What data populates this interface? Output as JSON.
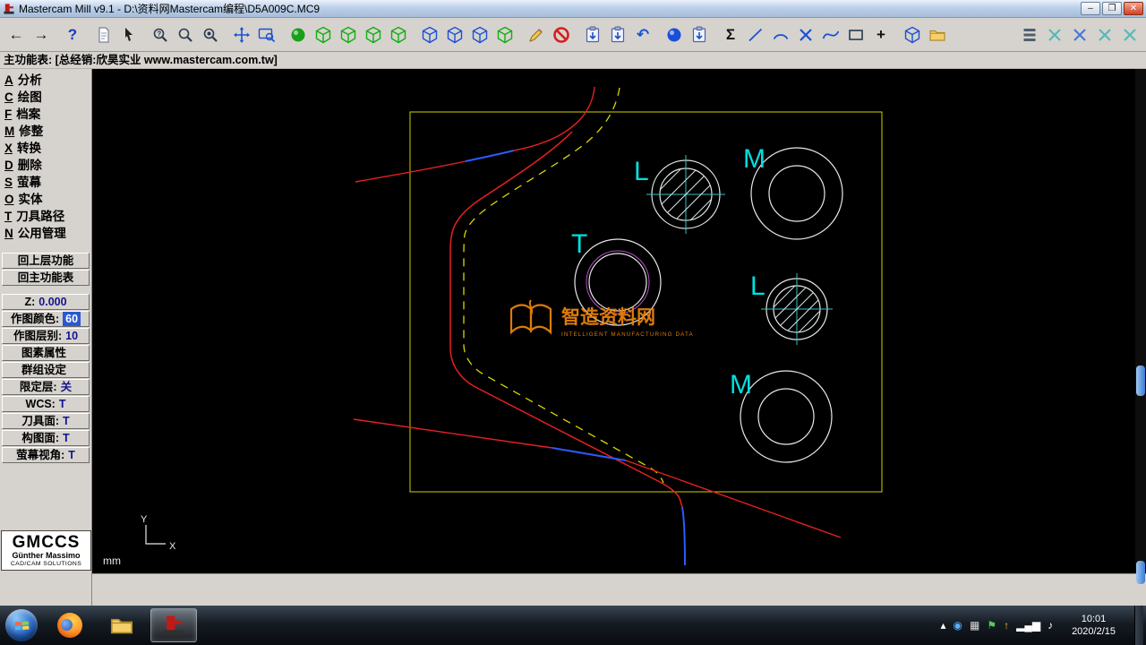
{
  "window": {
    "title": "Mastercam Mill v9.1 - D:\\资料网Mastercam编程\\D5A009C.MC9",
    "minimize": "–",
    "maximize": "❐",
    "close": "✕"
  },
  "statusbar": {
    "text": "主功能表: [总经销:欣昊实业 www.mastercam.com.tw]"
  },
  "toolbar": {
    "icons": [
      {
        "name": "back-arrow-icon",
        "glyph": "←",
        "color": "#101010"
      },
      {
        "name": "forward-arrow-icon",
        "glyph": "→",
        "color": "#101010"
      },
      {
        "name": "help-icon",
        "glyph": "?",
        "color": "#1838c8",
        "gap": true
      },
      {
        "name": "new-file-icon",
        "sym": "page",
        "gap": true
      },
      {
        "name": "analyze-cursor-icon",
        "sym": "cursor"
      },
      {
        "name": "zoom-question-icon",
        "sym": "magq",
        "color": "#2a3a50",
        "gap": true
      },
      {
        "name": "zoom-window-icon",
        "sym": "mag",
        "color": "#2a3a50"
      },
      {
        "name": "zoom-target-icon",
        "sym": "mag8",
        "color": "#2a3a50"
      },
      {
        "name": "pan-icon",
        "sym": "pan",
        "color": "#1a50d8",
        "gap": true
      },
      {
        "name": "fit-screen-icon",
        "sym": "screenmag",
        "color": "#1a50d8"
      },
      {
        "name": "shaded-sphere-icon",
        "sym": "sphere",
        "color": "#18a018",
        "gap": true
      },
      {
        "name": "gview-iso-icon",
        "sym": "cube",
        "color": "#0fae0f"
      },
      {
        "name": "gview-top-icon",
        "sym": "cube",
        "color": "#0fae0f"
      },
      {
        "name": "gview-front-icon",
        "sym": "cube",
        "color": "#0fae0f"
      },
      {
        "name": "gview-side-icon",
        "sym": "cube",
        "color": "#0fae0f"
      },
      {
        "name": "cplane-3d-icon",
        "sym": "cube",
        "color": "#1a50d8",
        "gap": true
      },
      {
        "name": "cplane-top-icon",
        "sym": "cube",
        "color": "#1a50d8"
      },
      {
        "name": "cplane-front-icon",
        "sym": "cube",
        "color": "#1a50d8"
      },
      {
        "name": "cplane-side-icon",
        "sym": "cube",
        "color": "#0fae0f"
      },
      {
        "name": "draw-pencil-icon",
        "sym": "pencil",
        "gap": true
      },
      {
        "name": "delete-ban-icon",
        "sym": "ban"
      },
      {
        "name": "screen-paint-icon",
        "sym": "clip",
        "gap": true
      },
      {
        "name": "screen-copy-icon",
        "sym": "clip"
      },
      {
        "name": "undo-icon",
        "glyph": "↶",
        "color": "#1a50d8"
      },
      {
        "name": "world-icon",
        "sym": "sphere",
        "color": "#1a50d8",
        "gap": true
      },
      {
        "name": "clipboard-icon",
        "sym": "clip"
      },
      {
        "name": "sigma-icon",
        "glyph": "Σ",
        "color": "#101010",
        "gap": true
      },
      {
        "name": "line-icon",
        "sym": "line",
        "color": "#1a50d8"
      },
      {
        "name": "arc-icon",
        "sym": "arc",
        "color": "#1a50d8"
      },
      {
        "name": "modify-trim-icon",
        "sym": "xtrim",
        "color": "#1a50d8"
      },
      {
        "name": "spline-icon",
        "sym": "spline",
        "color": "#1a50d8"
      },
      {
        "name": "rectangle-icon",
        "sym": "rect",
        "color": "#2a3a50"
      },
      {
        "name": "plus-icon",
        "glyph": "+",
        "color": "#101010"
      },
      {
        "name": "dynamic-cube-icon",
        "sym": "cube",
        "color": "#1a50d8",
        "gap": true
      },
      {
        "name": "folder-icon",
        "sym": "folder"
      },
      {
        "name": "layers-list-icon",
        "sym": "layers",
        "color": "#506070",
        "push": true
      },
      {
        "name": "trim-1-icon",
        "sym": "xtrim",
        "color": "#58b8b8"
      },
      {
        "name": "trim-2-icon",
        "sym": "xtrim",
        "color": "#4878d8"
      },
      {
        "name": "trim-3-icon",
        "sym": "xtrim",
        "color": "#58b8b8"
      },
      {
        "name": "trim-4-icon",
        "sym": "xtrim",
        "color": "#58b8b8"
      }
    ]
  },
  "sidebar": {
    "menu_items": [
      {
        "name": "menu-analysis",
        "key": "A",
        "label": "分析"
      },
      {
        "name": "menu-create",
        "key": "C",
        "label": "绘图"
      },
      {
        "name": "menu-file",
        "key": "F",
        "label": "档案"
      },
      {
        "name": "menu-modify",
        "key": "M",
        "label": "修整"
      },
      {
        "name": "menu-xform",
        "key": "X",
        "label": "转换"
      },
      {
        "name": "menu-delete",
        "key": "D",
        "label": "删除"
      },
      {
        "name": "menu-screen",
        "key": "S",
        "label": "萤幕"
      },
      {
        "name": "menu-solids",
        "key": "O",
        "label": "实体"
      },
      {
        "name": "menu-toolpaths",
        "key": "T",
        "label": "刀具路径"
      },
      {
        "name": "menu-nc-utils",
        "key": "N",
        "label": "公用管理"
      }
    ],
    "backup_button": "回上层功能",
    "main_menu_button": "回主功能表",
    "fields": [
      {
        "name": "z-depth-field",
        "label": "Z:",
        "value": "0.000"
      },
      {
        "name": "color-field",
        "label": "作图颜色:",
        "value": "60",
        "highlight": true
      },
      {
        "name": "level-field",
        "label": "作图层别:",
        "value": "10"
      },
      {
        "name": "attributes-button",
        "label": "图素属性",
        "value": ""
      },
      {
        "name": "groups-button",
        "label": "群组设定",
        "value": ""
      },
      {
        "name": "limit-level-field",
        "label": "限定层:",
        "value": "关"
      },
      {
        "name": "wcs-field",
        "label": "WCS:",
        "value": "T"
      },
      {
        "name": "tool-plane-field",
        "label": "刀具面:",
        "value": "T"
      },
      {
        "name": "cplane-field",
        "label": "构图面:",
        "value": "T"
      },
      {
        "name": "gview-field",
        "label": "萤幕视角:",
        "value": "T"
      }
    ],
    "logo": {
      "title": "GMCCS",
      "line1": "Günther Massimo",
      "line2": "CAD/CAM SOLUTIONS"
    }
  },
  "canvas": {
    "labels": [
      {
        "text": "L"
      },
      {
        "text": "M"
      },
      {
        "text": "T"
      },
      {
        "text": "L"
      },
      {
        "text": "M"
      }
    ],
    "axis": {
      "x": "X",
      "y": "Y"
    },
    "units": "mm",
    "watermark": {
      "title": "智造资料网",
      "subtitle": "INTELLIGENT MANUFACTURING DATA"
    }
  },
  "taskbar": {
    "tray": [
      {
        "name": "tray-expand-icon",
        "glyph": "▴",
        "color": "#ffffff"
      },
      {
        "name": "tray-app1-icon",
        "glyph": "◉",
        "color": "#58b0ff"
      },
      {
        "name": "tray-app2-icon",
        "glyph": "▦",
        "color": "#d8d8d8"
      },
      {
        "name": "tray-shield-icon",
        "glyph": "⚑",
        "color": "#58c858"
      },
      {
        "name": "tray-update-icon",
        "glyph": "↑",
        "color": "#e8b838"
      },
      {
        "name": "tray-network-icon",
        "glyph": "▂▄▆",
        "color": "#ffffff"
      },
      {
        "name": "tray-volume-icon",
        "glyph": "♪",
        "color": "#ffffff"
      }
    ],
    "clock": {
      "time": "10:01",
      "date": "2020/2/15"
    }
  },
  "colors": {
    "entity_white": "#e8e8e8",
    "entity_cyan": "#00e0e0",
    "entity_yellow": "#d8d800",
    "entity_red": "#e82020",
    "entity_blue": "#2b5bff",
    "entity_magenta": "#b44fc4",
    "watermark_orange": "#e8820c",
    "highlight_blue": "#2a5ad0"
  }
}
